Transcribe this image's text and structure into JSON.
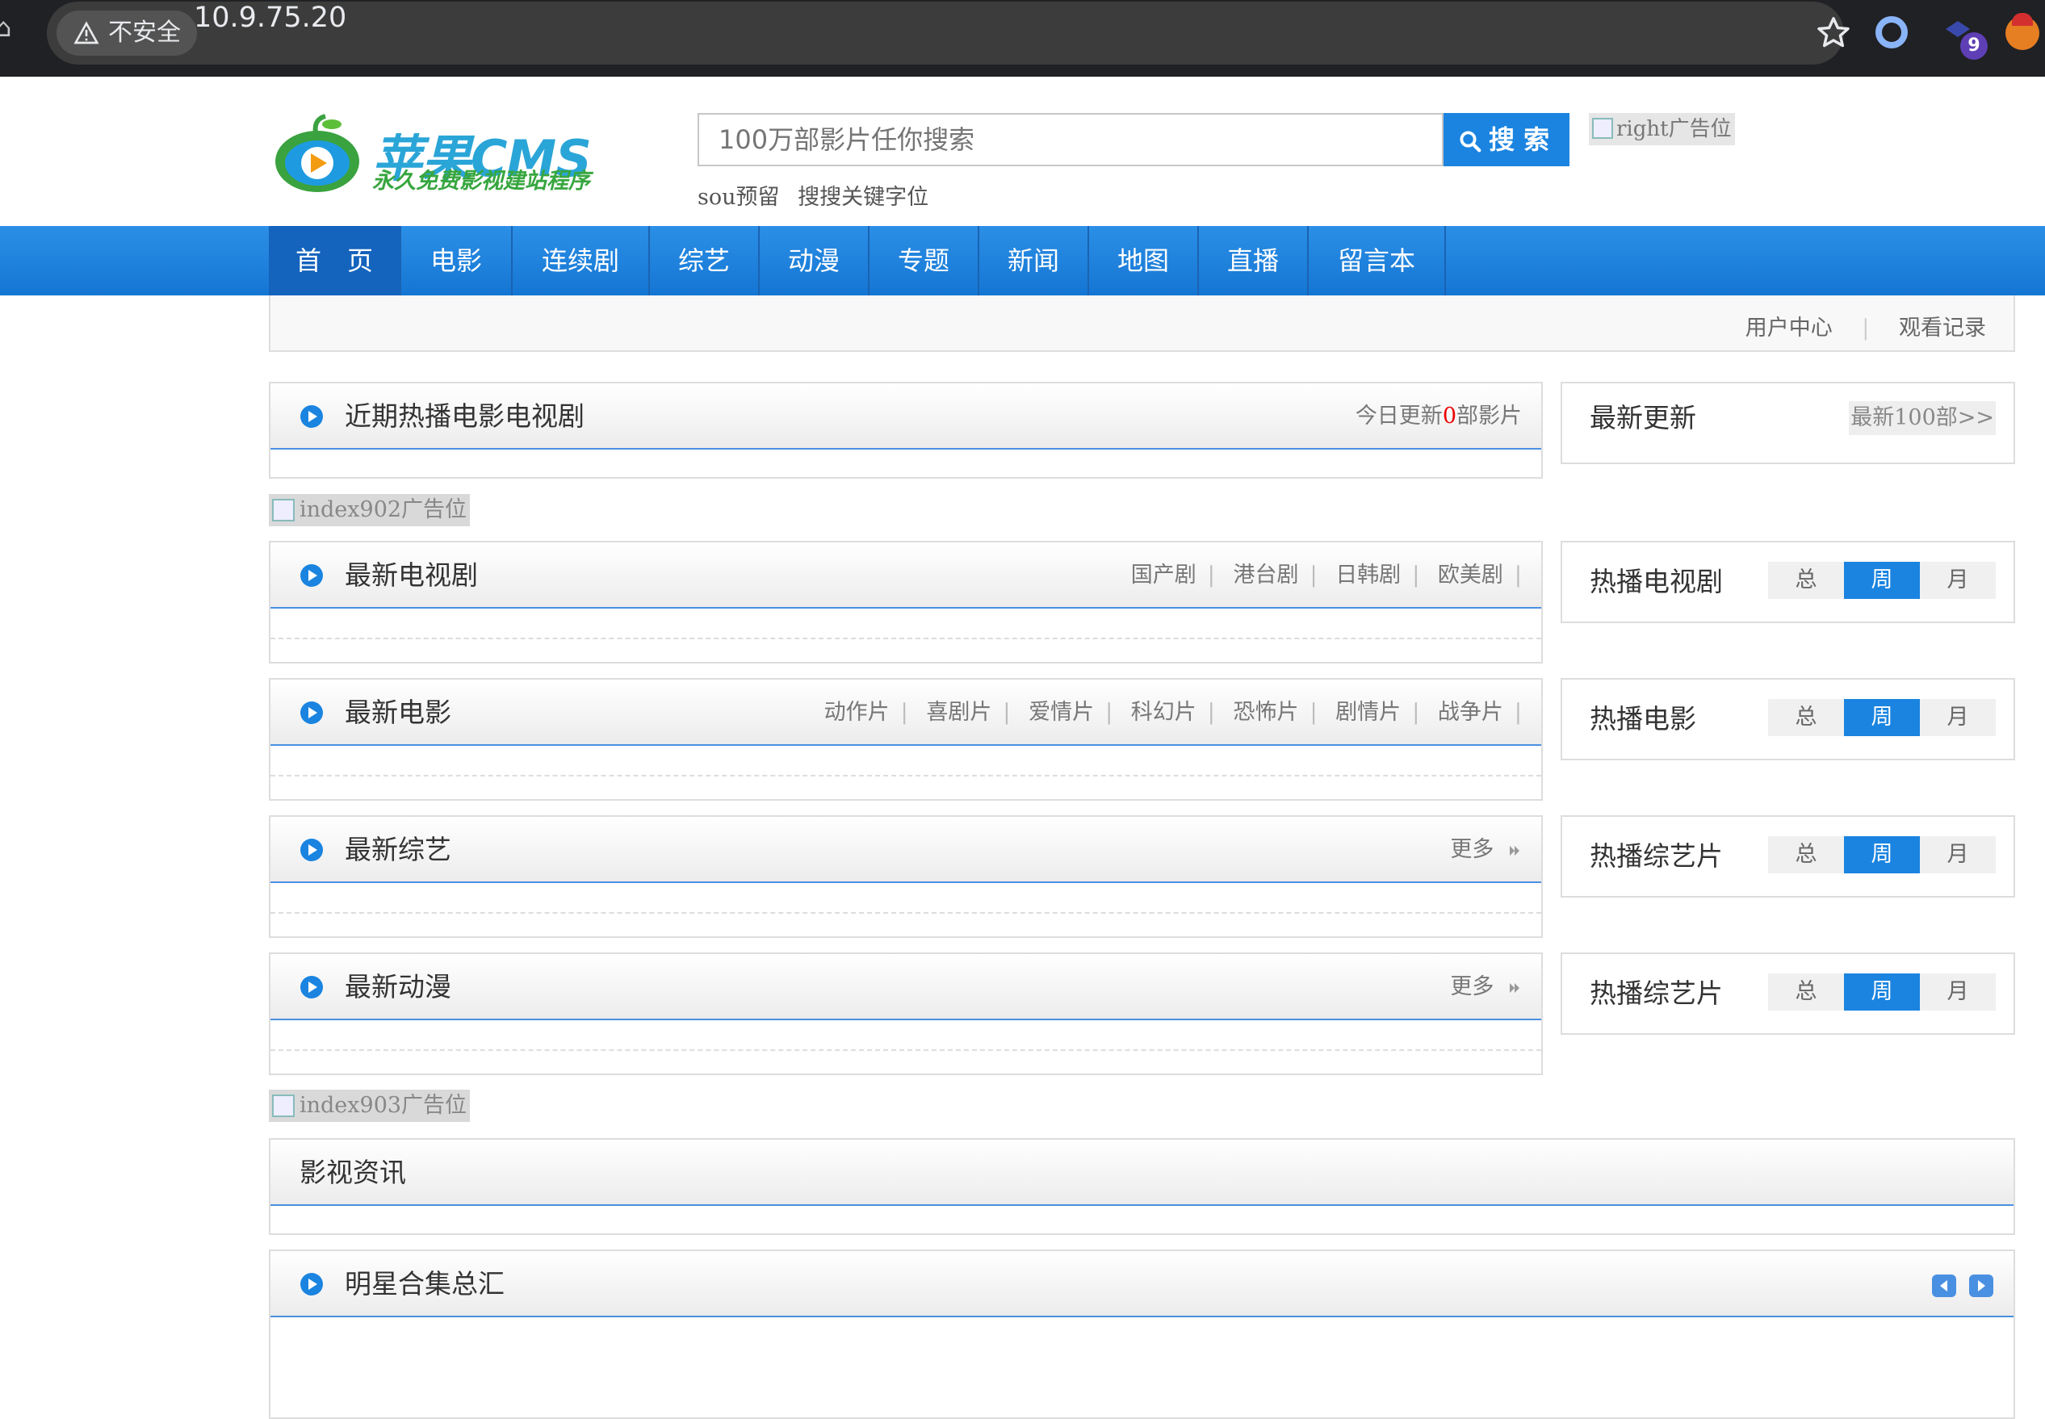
{
  "browser": {
    "security_label": "不安全",
    "url": "10.9.75.20",
    "extension_badge": "9"
  },
  "header": {
    "logo_text": "苹果CMS",
    "logo_subtitle": "永久免费影视建站程序",
    "search_placeholder": "100万部影片任你搜索",
    "search_button": "搜 索",
    "ad_right": "right广告位",
    "hotwords": [
      "sou预留",
      "搜搜关键字位"
    ]
  },
  "nav": {
    "items": [
      "首　页",
      "电影",
      "连续剧",
      "综艺",
      "动漫",
      "专题",
      "新闻",
      "地图",
      "直播",
      "留言本"
    ],
    "active_index": 0
  },
  "user_bar": {
    "user_center": "用户中心",
    "watch_history": "观看记录"
  },
  "hot": {
    "title": "近期热播电影电视剧",
    "update_prefix": "今日更新",
    "update_count": "0",
    "update_suffix": "部影片"
  },
  "latest_updates": {
    "title": "最新更新",
    "more": "最新100部>>"
  },
  "ads": {
    "index902": "index902广告位",
    "index903": "index903广告位"
  },
  "sections": {
    "tv": {
      "title": "最新电视剧",
      "links": [
        "国产剧",
        "港台剧",
        "日韩剧",
        "欧美剧"
      ],
      "side_title": "热播电视剧"
    },
    "movie": {
      "title": "最新电影",
      "links": [
        "动作片",
        "喜剧片",
        "爱情片",
        "科幻片",
        "恐怖片",
        "剧情片",
        "战争片"
      ],
      "side_title": "热播电影"
    },
    "variety": {
      "title": "最新综艺",
      "more": "更多",
      "side_title": "热播综艺片"
    },
    "anime": {
      "title": "最新动漫",
      "more": "更多",
      "side_title": "热播综艺片"
    }
  },
  "rank_tabs": [
    "总",
    "周",
    "月"
  ],
  "news": {
    "title": "影视资讯"
  },
  "stars": {
    "title": "明星合集总汇"
  },
  "colors": {
    "accent": "#1a84e0",
    "nav_gradient_top": "#2c8fe6",
    "nav_active": "#1463bd",
    "highlight_red": "#e00000"
  }
}
